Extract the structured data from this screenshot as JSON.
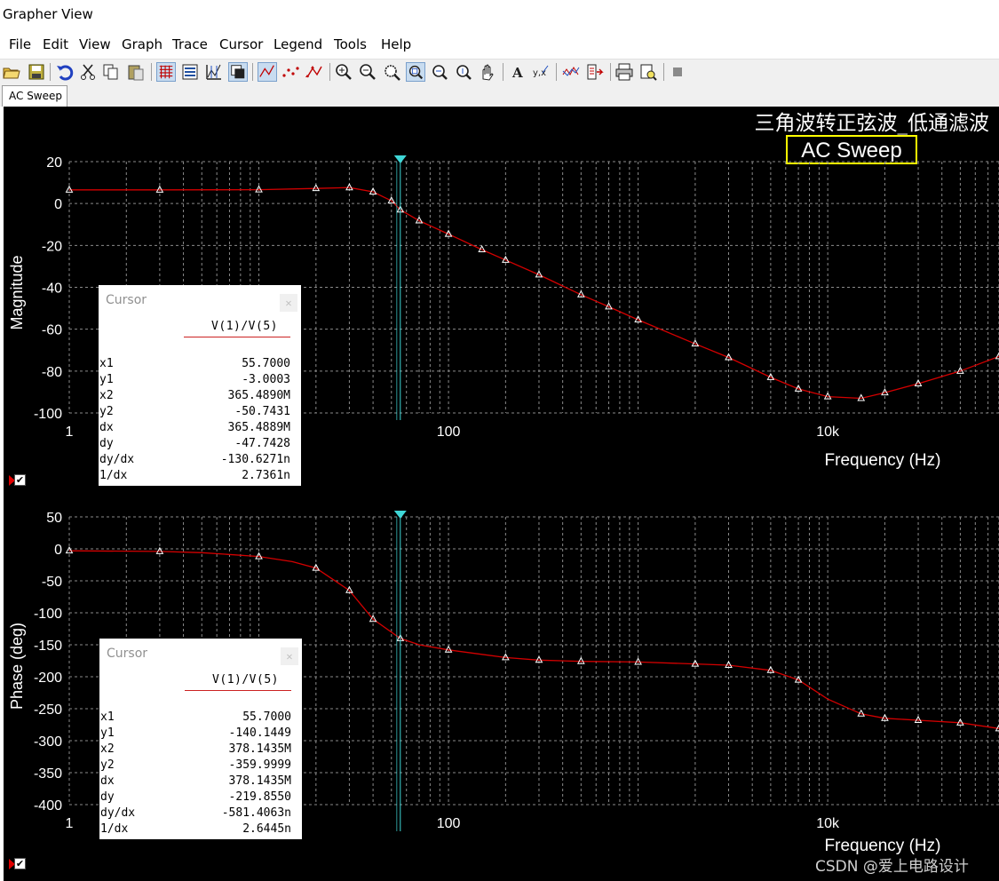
{
  "window": {
    "title": "Grapher View"
  },
  "menu": [
    "File",
    "Edit",
    "View",
    "Graph",
    "Trace",
    "Cursor",
    "Legend",
    "Tools",
    "Help"
  ],
  "tab": {
    "label": "AC Sweep"
  },
  "graph": {
    "title": "三角波转正弦波_低通滤波",
    "subtitle": "AC Sweep",
    "colors": {
      "background": "#000000",
      "grid": "#8a8a8a",
      "trace": "#d40000",
      "cursor": "#3fd7d7",
      "axis_text": "#ffffff",
      "subtitle_border": "#ffff00"
    }
  },
  "chart_data": [
    {
      "type": "line",
      "ylabel": "Magnitude",
      "xlabel": "Frequency (Hz)",
      "xscale": "log",
      "xlim": [
        1,
        80000
      ],
      "ylim": [
        -100,
        20
      ],
      "xtick_labels": [
        "1",
        "100",
        "10k"
      ],
      "ytick_labels": [
        "20",
        "0",
        "-20",
        "-40",
        "-60",
        "-80",
        "-100"
      ],
      "grid": true,
      "series": [
        {
          "name": "V(1)/V(5)",
          "x": [
            1,
            3,
            10,
            20,
            30,
            40,
            50,
            55.7,
            70,
            100,
            150,
            200,
            300,
            500,
            700,
            1000,
            2000,
            3000,
            5000,
            7000,
            10000,
            15000,
            20000,
            30000,
            50000,
            80000
          ],
          "y": [
            6.5,
            6.5,
            6.6,
            7.2,
            7.6,
            5.6,
            1.3,
            -3.0,
            -8.2,
            -14.6,
            -22,
            -27,
            -34,
            -43.5,
            -49.3,
            -55.5,
            -67,
            -73.5,
            -83,
            -88.5,
            -92.2,
            -93,
            -90.3,
            -86,
            -80,
            -73
          ]
        }
      ],
      "cursor_x": 55.7
    },
    {
      "type": "line",
      "ylabel": "Phase (deg)",
      "xlabel": "Frequency (Hz)",
      "xscale": "log",
      "xlim": [
        1,
        80000
      ],
      "ylim": [
        -400,
        50
      ],
      "xtick_labels": [
        "1",
        "100",
        "10k"
      ],
      "ytick_labels": [
        "50",
        "0",
        "-50",
        "-100",
        "-150",
        "-200",
        "-250",
        "-300",
        "-350",
        "-400"
      ],
      "grid": true,
      "series": [
        {
          "name": "V(1)/V(5)",
          "x": [
            1,
            3,
            5,
            10,
            15,
            20,
            30,
            40,
            55.7,
            70,
            100,
            150,
            200,
            300,
            500,
            1000,
            2000,
            3000,
            5000,
            7000,
            10000,
            15000,
            20000,
            30000,
            50000,
            80000
          ],
          "y": [
            -3,
            -4,
            -6,
            -12,
            -20,
            -30,
            -65,
            -110,
            -140.1,
            -150,
            -158,
            -165,
            -170,
            -174,
            -176,
            -177,
            -180,
            -182,
            -190,
            -205,
            -235,
            -258,
            -265,
            -268,
            -272,
            -281
          ],
          "markers_x": [
            1,
            3,
            10,
            20,
            30,
            40,
            55.7,
            100,
            200,
            300,
            500,
            1000,
            2000,
            3000,
            5000,
            7000,
            15000,
            20000,
            30000,
            50000,
            80000
          ]
        }
      ],
      "cursor_x": 55.7
    }
  ],
  "cursor_panels": [
    {
      "title": "Cursor",
      "trace": "V(1)/V(5)",
      "rows": [
        {
          "k": "x1",
          "v": "55.7000"
        },
        {
          "k": "y1",
          "v": "-3.0003"
        },
        {
          "k": "x2",
          "v": "365.4890M"
        },
        {
          "k": "y2",
          "v": "-50.7431"
        },
        {
          "k": "dx",
          "v": "365.4889M"
        },
        {
          "k": "dy",
          "v": "-47.7428"
        },
        {
          "k": "dy/dx",
          "v": "-130.6271n"
        },
        {
          "k": "1/dx",
          "v": "2.7361n"
        }
      ]
    },
    {
      "title": "Cursor",
      "trace": "V(1)/V(5)",
      "rows": [
        {
          "k": "x1",
          "v": "55.7000"
        },
        {
          "k": "y1",
          "v": "-140.1449"
        },
        {
          "k": "x2",
          "v": "378.1435M"
        },
        {
          "k": "y2",
          "v": "-359.9999"
        },
        {
          "k": "dx",
          "v": "378.1435M"
        },
        {
          "k": "dy",
          "v": "-219.8550"
        },
        {
          "k": "dy/dx",
          "v": "-581.4063n"
        },
        {
          "k": "1/dx",
          "v": "2.6445n"
        }
      ]
    }
  ],
  "legends": [
    "V(1)/V(5)",
    "V(1)/V(5)"
  ],
  "watermark": "CSDN @爱上电路设计"
}
